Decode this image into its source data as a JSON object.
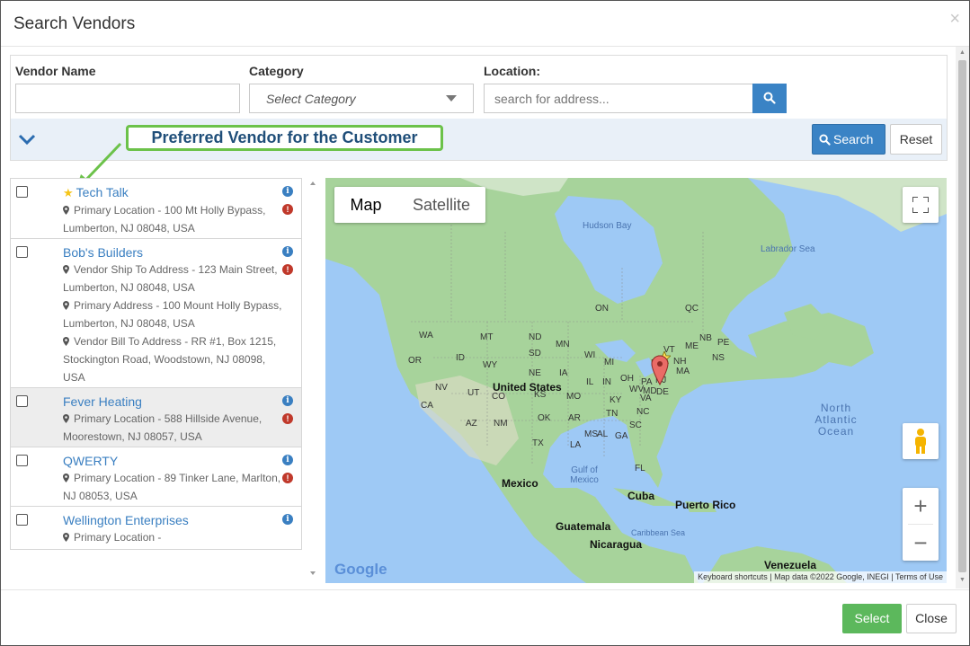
{
  "modal": {
    "title": "Search Vendors",
    "close_symbol": "×"
  },
  "form": {
    "vendor_name_label": "Vendor Name",
    "vendor_name_value": "",
    "category_label": "Category",
    "category_selected": "Select Category",
    "location_label": "Location:",
    "location_placeholder": "search for address..."
  },
  "toolbar": {
    "annotation": "Preferred Vendor for the Customer",
    "search_label": "Search",
    "reset_label": "Reset"
  },
  "vendors": [
    {
      "name": "Tech Talk",
      "preferred": true,
      "addresses": [
        "Primary Location - 100 Mt Holly Bypass, Lumberton, NJ 08048, USA"
      ]
    },
    {
      "name": "Bob's Builders",
      "preferred": false,
      "addresses": [
        "Vendor Ship To Address - 123 Main Street, Lumberton, NJ 08048, USA",
        "Primary Address - 100 Mount Holly Bypass, Lumberton, NJ 08048, USA",
        "Vendor Bill To Address - RR #1, Box 1215, Stockington Road, Woodstown, NJ 08098, USA"
      ]
    },
    {
      "name": "Fever Heating",
      "preferred": false,
      "addresses": [
        "Primary Location - 588 Hillside Avenue, Moorestown, NJ 08057, USA"
      ]
    },
    {
      "name": "QWERTY",
      "preferred": false,
      "addresses": [
        "Primary Location - 89 Tinker Lane, Marlton, NJ 08053, USA"
      ]
    },
    {
      "name": "Wellington Enterprises",
      "preferred": false,
      "addresses": [
        "Primary Location -"
      ]
    }
  ],
  "map": {
    "tab_map": "Map",
    "tab_satellite": "Satellite",
    "labels": {
      "hudson_bay": "Hudson Bay",
      "labrador_sea": "Labrador Sea",
      "north_atlantic": "North Atlantic Ocean",
      "gulf_mexico": "Gulf of Mexico",
      "caribbean": "Caribbean Sea",
      "united_states": "United States",
      "mexico": "Mexico",
      "cuba": "Cuba",
      "puerto_rico": "Puerto Rico",
      "guatemala": "Guatemala",
      "nicaragua": "Nicaragua",
      "venezuela": "Venezuela",
      "states": [
        "WA",
        "OR",
        "CA",
        "NV",
        "ID",
        "MT",
        "WY",
        "UT",
        "AZ",
        "CO",
        "NM",
        "ND",
        "SD",
        "NE",
        "KS",
        "OK",
        "TX",
        "MN",
        "IA",
        "MO",
        "AR",
        "LA",
        "WI",
        "IL",
        "MS",
        "MI",
        "IN",
        "KY",
        "TN",
        "AL",
        "OH",
        "GA",
        "FL",
        "SC",
        "NC",
        "VA",
        "WV",
        "PA",
        "NY",
        "MD",
        "DE",
        "NJ",
        "VT",
        "ME",
        "NH",
        "MA",
        "NB",
        "NS",
        "PE",
        "ON",
        "QC"
      ]
    },
    "google_logo": "Google",
    "keyboard_shortcuts": "Keyboard shortcuts",
    "map_data": "Map data ©2022 Google, INEGI",
    "terms": "Terms of Use",
    "zoom_in": "+",
    "zoom_out": "−"
  },
  "footer": {
    "select_label": "Select",
    "close_label": "Close"
  },
  "colors": {
    "accent": "#3a83c5",
    "link": "#3a7fc1",
    "annotation_border": "#6cc24a",
    "select_green": "#5cb85c"
  }
}
